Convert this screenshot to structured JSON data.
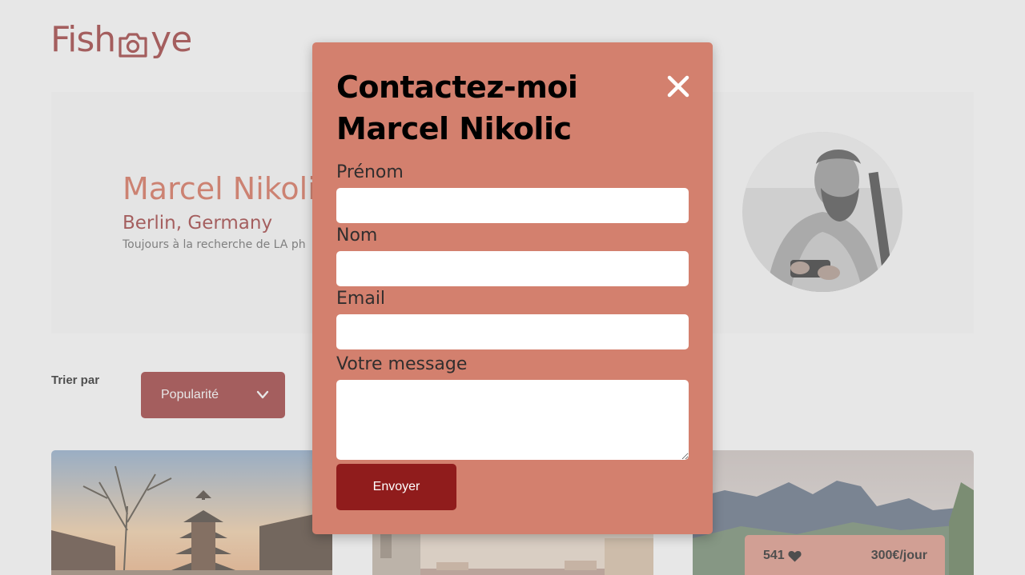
{
  "logo": {
    "text_left": "Fish",
    "text_right": "ye",
    "icon": "camera-icon"
  },
  "photographer": {
    "name": "Marcel Nikolic",
    "city": "Berlin, Germany",
    "tagline": "Toujours à la recherche de LA ph"
  },
  "sort": {
    "label": "Trier par",
    "selected": "Popularité",
    "icon": "chevron-down-icon"
  },
  "card": {
    "likes": "541",
    "like_icon": "heart-icon",
    "price": "300€/jour"
  },
  "modal": {
    "title_line1": "Contactez-moi",
    "title_line2": "Marcel Nikolic",
    "close_icon": "close-icon",
    "fields": {
      "first_name_label": "Prénom",
      "last_name_label": "Nom",
      "email_label": "Email",
      "message_label": "Votre message"
    },
    "submit_label": "Envoyer"
  },
  "colors": {
    "brand_dark": "#901c1c",
    "brand_primary": "#d3573c",
    "modal_bg": "#d3806e",
    "likes_bg": "#db8876",
    "header_bg": "#fafafa"
  }
}
